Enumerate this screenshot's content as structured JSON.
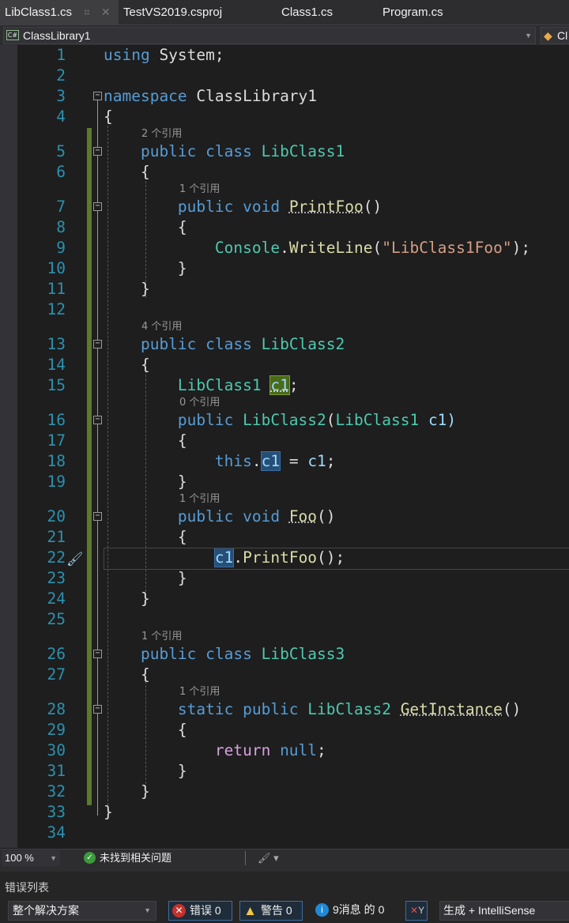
{
  "tabs": [
    {
      "label": "LibClass1.cs",
      "active": true
    },
    {
      "label": "TestVS2019.csproj"
    },
    {
      "label": "Class1.cs"
    },
    {
      "label": "Program.cs"
    }
  ],
  "navbar": {
    "project": "ClassLibrary1",
    "member": "Cl"
  },
  "code": [
    {
      "n": "1",
      "t": [
        [
          "using",
          "k"
        ],
        [
          " System;",
          "p"
        ]
      ]
    },
    {
      "n": "2",
      "t": []
    },
    {
      "n": "3",
      "fold": true,
      "t": [
        [
          "namespace",
          "k"
        ],
        [
          " ClassLibrary1",
          "p"
        ]
      ]
    },
    {
      "n": "4",
      "t": [
        [
          "{",
          "p"
        ]
      ]
    },
    {
      "lens": "2 个引用",
      "indent": 4
    },
    {
      "n": "5",
      "fold": true,
      "t": [
        [
          "    public class ",
          "k"
        ],
        [
          "LibClass1",
          "t"
        ]
      ]
    },
    {
      "n": "6",
      "t": [
        [
          "    {",
          "p"
        ]
      ]
    },
    {
      "lens": "1 个引用",
      "indent": 8
    },
    {
      "n": "7",
      "fold": true,
      "t": [
        [
          "        public void ",
          "k"
        ],
        [
          "PrintFoo",
          "m",
          "dotu"
        ],
        [
          "()",
          "p"
        ]
      ]
    },
    {
      "n": "8",
      "t": [
        [
          "        {",
          "p"
        ]
      ]
    },
    {
      "n": "9",
      "t": [
        [
          "            Console",
          "t"
        ],
        [
          ".",
          "p"
        ],
        [
          "WriteLine",
          "m"
        ],
        [
          "(",
          "p"
        ],
        [
          "\"LibClass1Foo\"",
          "s"
        ],
        [
          ");",
          "p"
        ]
      ]
    },
    {
      "n": "10",
      "t": [
        [
          "        }",
          "p"
        ]
      ]
    },
    {
      "n": "11",
      "t": [
        [
          "    }",
          "p"
        ]
      ]
    },
    {
      "n": "12",
      "t": []
    },
    {
      "lens": "4 个引用",
      "indent": 4
    },
    {
      "n": "13",
      "fold": true,
      "t": [
        [
          "    public class ",
          "k"
        ],
        [
          "LibClass2",
          "t"
        ]
      ]
    },
    {
      "n": "14",
      "t": [
        [
          "    {",
          "p"
        ]
      ]
    },
    {
      "n": "15",
      "t": [
        [
          "        LibClass1 ",
          "t"
        ],
        [
          "c1",
          "v",
          "hl-green"
        ],
        [
          ";",
          "p"
        ]
      ]
    },
    {
      "lens": "0 个引用",
      "indent": 8
    },
    {
      "n": "16",
      "fold": true,
      "t": [
        [
          "        public ",
          "k"
        ],
        [
          "LibClass2",
          "t"
        ],
        [
          "(",
          "p"
        ],
        [
          "LibClass1",
          "t"
        ],
        [
          " c1)",
          "v"
        ]
      ]
    },
    {
      "n": "17",
      "t": [
        [
          "        {",
          "p"
        ]
      ]
    },
    {
      "n": "18",
      "t": [
        [
          "            this",
          "k"
        ],
        [
          ".",
          "p"
        ],
        [
          "c1",
          "v",
          "hl-blue"
        ],
        [
          " = ",
          "p"
        ],
        [
          "c1",
          "v"
        ],
        [
          ";",
          "p"
        ]
      ]
    },
    {
      "n": "19",
      "t": [
        [
          "        }",
          "p"
        ]
      ]
    },
    {
      "lens": "1 个引用",
      "indent": 8
    },
    {
      "n": "20",
      "fold": true,
      "t": [
        [
          "        public void ",
          "k"
        ],
        [
          "Foo",
          "m",
          "dotu"
        ],
        [
          "()",
          "p"
        ]
      ]
    },
    {
      "n": "21",
      "t": [
        [
          "        {",
          "p"
        ]
      ]
    },
    {
      "n": "22",
      "cur": true,
      "t": [
        [
          "            ",
          "p"
        ],
        [
          "c1",
          "v",
          "hl-blue"
        ],
        [
          ".",
          "p"
        ],
        [
          "PrintFoo",
          "m"
        ],
        [
          "();",
          "p"
        ]
      ]
    },
    {
      "n": "23",
      "t": [
        [
          "        }",
          "p"
        ]
      ]
    },
    {
      "n": "24",
      "t": [
        [
          "    }",
          "p"
        ]
      ]
    },
    {
      "n": "25",
      "t": []
    },
    {
      "lens": "1 个引用",
      "indent": 4
    },
    {
      "n": "26",
      "fold": true,
      "t": [
        [
          "    public class ",
          "k"
        ],
        [
          "LibClass3",
          "t"
        ]
      ]
    },
    {
      "n": "27",
      "t": [
        [
          "    {",
          "p"
        ]
      ]
    },
    {
      "lens": "1 个引用",
      "indent": 8
    },
    {
      "n": "28",
      "fold": true,
      "t": [
        [
          "        static public ",
          "k"
        ],
        [
          "LibClass2 ",
          "t"
        ],
        [
          "GetInstance",
          "m",
          "dotu"
        ],
        [
          "()",
          "p"
        ]
      ]
    },
    {
      "n": "29",
      "t": [
        [
          "        {",
          "p"
        ]
      ]
    },
    {
      "n": "30",
      "t": [
        [
          "            return ",
          "c"
        ],
        [
          "null",
          "k"
        ],
        [
          ";",
          "p"
        ]
      ]
    },
    {
      "n": "31",
      "t": [
        [
          "        }",
          "p"
        ]
      ]
    },
    {
      "n": "32",
      "t": [
        [
          "    }",
          "p"
        ]
      ]
    },
    {
      "n": "33",
      "t": [
        [
          "}",
          "p"
        ]
      ]
    },
    {
      "n": "34",
      "t": []
    }
  ],
  "status": {
    "zoom": "100 %",
    "issues": "未找到相关问题"
  },
  "error_list": {
    "title": "错误列表",
    "scope": "整个解决方案",
    "errors": "错误 0",
    "warnings": "警告 0",
    "messages": "9消息 的 0",
    "source": "生成 + IntelliSense"
  },
  "colors": {
    "keyword": "#569cd6",
    "type": "#4ec9b0",
    "method": "#dcdcaa",
    "string": "#d69d85",
    "line_number": "#2b91af"
  }
}
